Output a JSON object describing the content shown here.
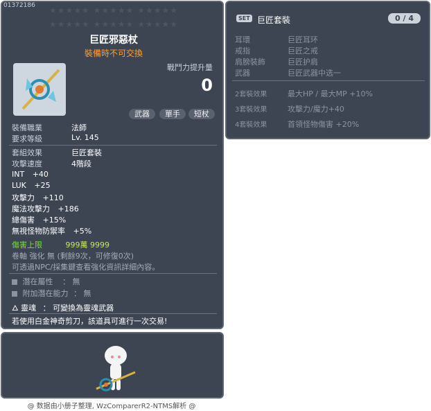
{
  "item": {
    "id": "01372186",
    "stars_row1": "★★★★★ ★★★★★ ★★★★★",
    "stars_row2": "★★★★★ ★★★★★ ★★★★★",
    "name": "巨匠邪惡杖",
    "untradeable": "裝備時不可交換",
    "power_label": "戰鬥力提升量",
    "power_value": "0",
    "tags": [
      "武器",
      "單手",
      "短杖"
    ],
    "job_label": "裝備職業",
    "job_value": "法師",
    "level_label": "要求等級",
    "level_value": "Lv. 145",
    "set_label": "套組效果",
    "set_value": "巨匠套裝",
    "speed_label": "攻擊速度",
    "speed_value": "4階段",
    "stats": [
      {
        "label": "INT",
        "value": "+40"
      },
      {
        "label": "LUK",
        "value": "+25"
      },
      {
        "label": "攻擊力",
        "value": "+110"
      },
      {
        "label": "魔法攻擊力",
        "value": "+186"
      },
      {
        "label": "總傷害",
        "value": "+15%"
      },
      {
        "label": "無視怪物防禦率",
        "value": "+5%"
      }
    ],
    "damage_cap_label": "傷害上限",
    "damage_cap_value": "999萬 9999",
    "scroll_text": "卷軸 強化 無 (剩餘9次，可修復0次)",
    "npc_text": "可透過NPC/採集鍵查看強化資訊詳細內容。",
    "potential_label": "潛在屬性",
    "potential_value": "： 無",
    "bonus_potential_label": "附加潛在能力",
    "bonus_potential_value": "： 無",
    "soul_label": "靈魂",
    "soul_value": "： 可變換為靈魂武器",
    "scissors_text": "若使用白金神奇剪刀，該道具可進行一次交易!"
  },
  "set": {
    "badge": "SET",
    "title": "巨匠套裝",
    "count": "0 / 4",
    "parts": [
      {
        "slot": "耳環",
        "name": "巨匠耳环"
      },
      {
        "slot": "戒指",
        "name": "巨匠之戒"
      },
      {
        "slot": "肩膀裝飾",
        "name": "巨匠护肩"
      },
      {
        "slot": "武器",
        "name": "巨匠武器中选一"
      }
    ],
    "effects": [
      {
        "label": "2套裝效果",
        "text": "最大HP / 最大MP  +10%"
      },
      {
        "label": "3套裝效果",
        "text": "攻擊力/魔力+40"
      },
      {
        "label": "4套裝效果",
        "text": "首領怪物傷害 +20%"
      }
    ]
  },
  "footer": "@ 数据由小册子整理, WzComparerR2-NTMS解析 @",
  "colors": {
    "panel_bg": "#3d4552",
    "orange": "#ff9e33",
    "yellow_green": "#cbe85a",
    "green": "#70e22f"
  }
}
